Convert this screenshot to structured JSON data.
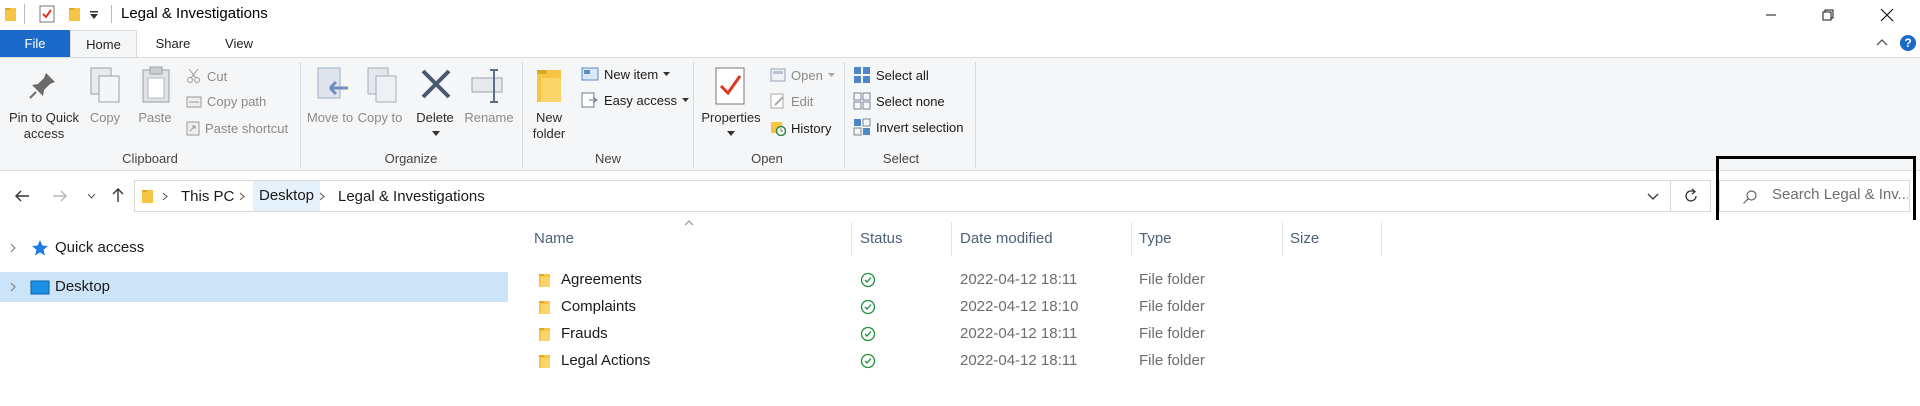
{
  "window": {
    "title": "Legal & Investigations"
  },
  "ribbon_tabs": [
    "File",
    "Home",
    "Share",
    "View"
  ],
  "clipboard": {
    "pin_label": "Pin to Quick access",
    "copy_label": "Copy",
    "paste_label": "Paste",
    "cut_label": "Cut",
    "copy_path_label": "Copy path",
    "paste_shortcut_label": "Paste shortcut",
    "group_label": "Clipboard"
  },
  "organize": {
    "move_to_label": "Move to",
    "copy_to_label": "Copy to",
    "delete_label": "Delete",
    "rename_label": "Rename",
    "group_label": "Organize"
  },
  "new_group": {
    "new_folder_label": "New folder",
    "new_item_label": "New item",
    "easy_access_label": "Easy access",
    "group_label": "New"
  },
  "open_group": {
    "properties_label": "Properties",
    "open_label": "Open",
    "edit_label": "Edit",
    "history_label": "History",
    "group_label": "Open"
  },
  "select_group": {
    "select_all_label": "Select all",
    "select_none_label": "Select none",
    "invert_selection_label": "Invert selection",
    "group_label": "Select"
  },
  "address": {
    "crumbs": [
      "This PC",
      "Desktop",
      "Legal & Investigations"
    ]
  },
  "search": {
    "placeholder": "Search Legal & Inv..."
  },
  "nav_pane": {
    "quick_access": "Quick access",
    "desktop": "Desktop"
  },
  "columns": [
    "Name",
    "Status",
    "Date modified",
    "Type",
    "Size"
  ],
  "files": [
    {
      "name": "Agreements",
      "modified": "2022-04-12 18:11",
      "type": "File folder"
    },
    {
      "name": "Complaints",
      "modified": "2022-04-12 18:10",
      "type": "File folder"
    },
    {
      "name": "Frauds",
      "modified": "2022-04-12 18:11",
      "type": "File folder"
    },
    {
      "name": "Legal Actions",
      "modified": "2022-04-12 18:11",
      "type": "File folder"
    }
  ],
  "colors": {
    "accent": "#1b6ac9",
    "selected": "#cce4f7",
    "folder": "#f8c444",
    "status_ok": "#1e8f3c"
  },
  "icons": {
    "status": "check-circle-icon",
    "folder": "folder-icon"
  }
}
